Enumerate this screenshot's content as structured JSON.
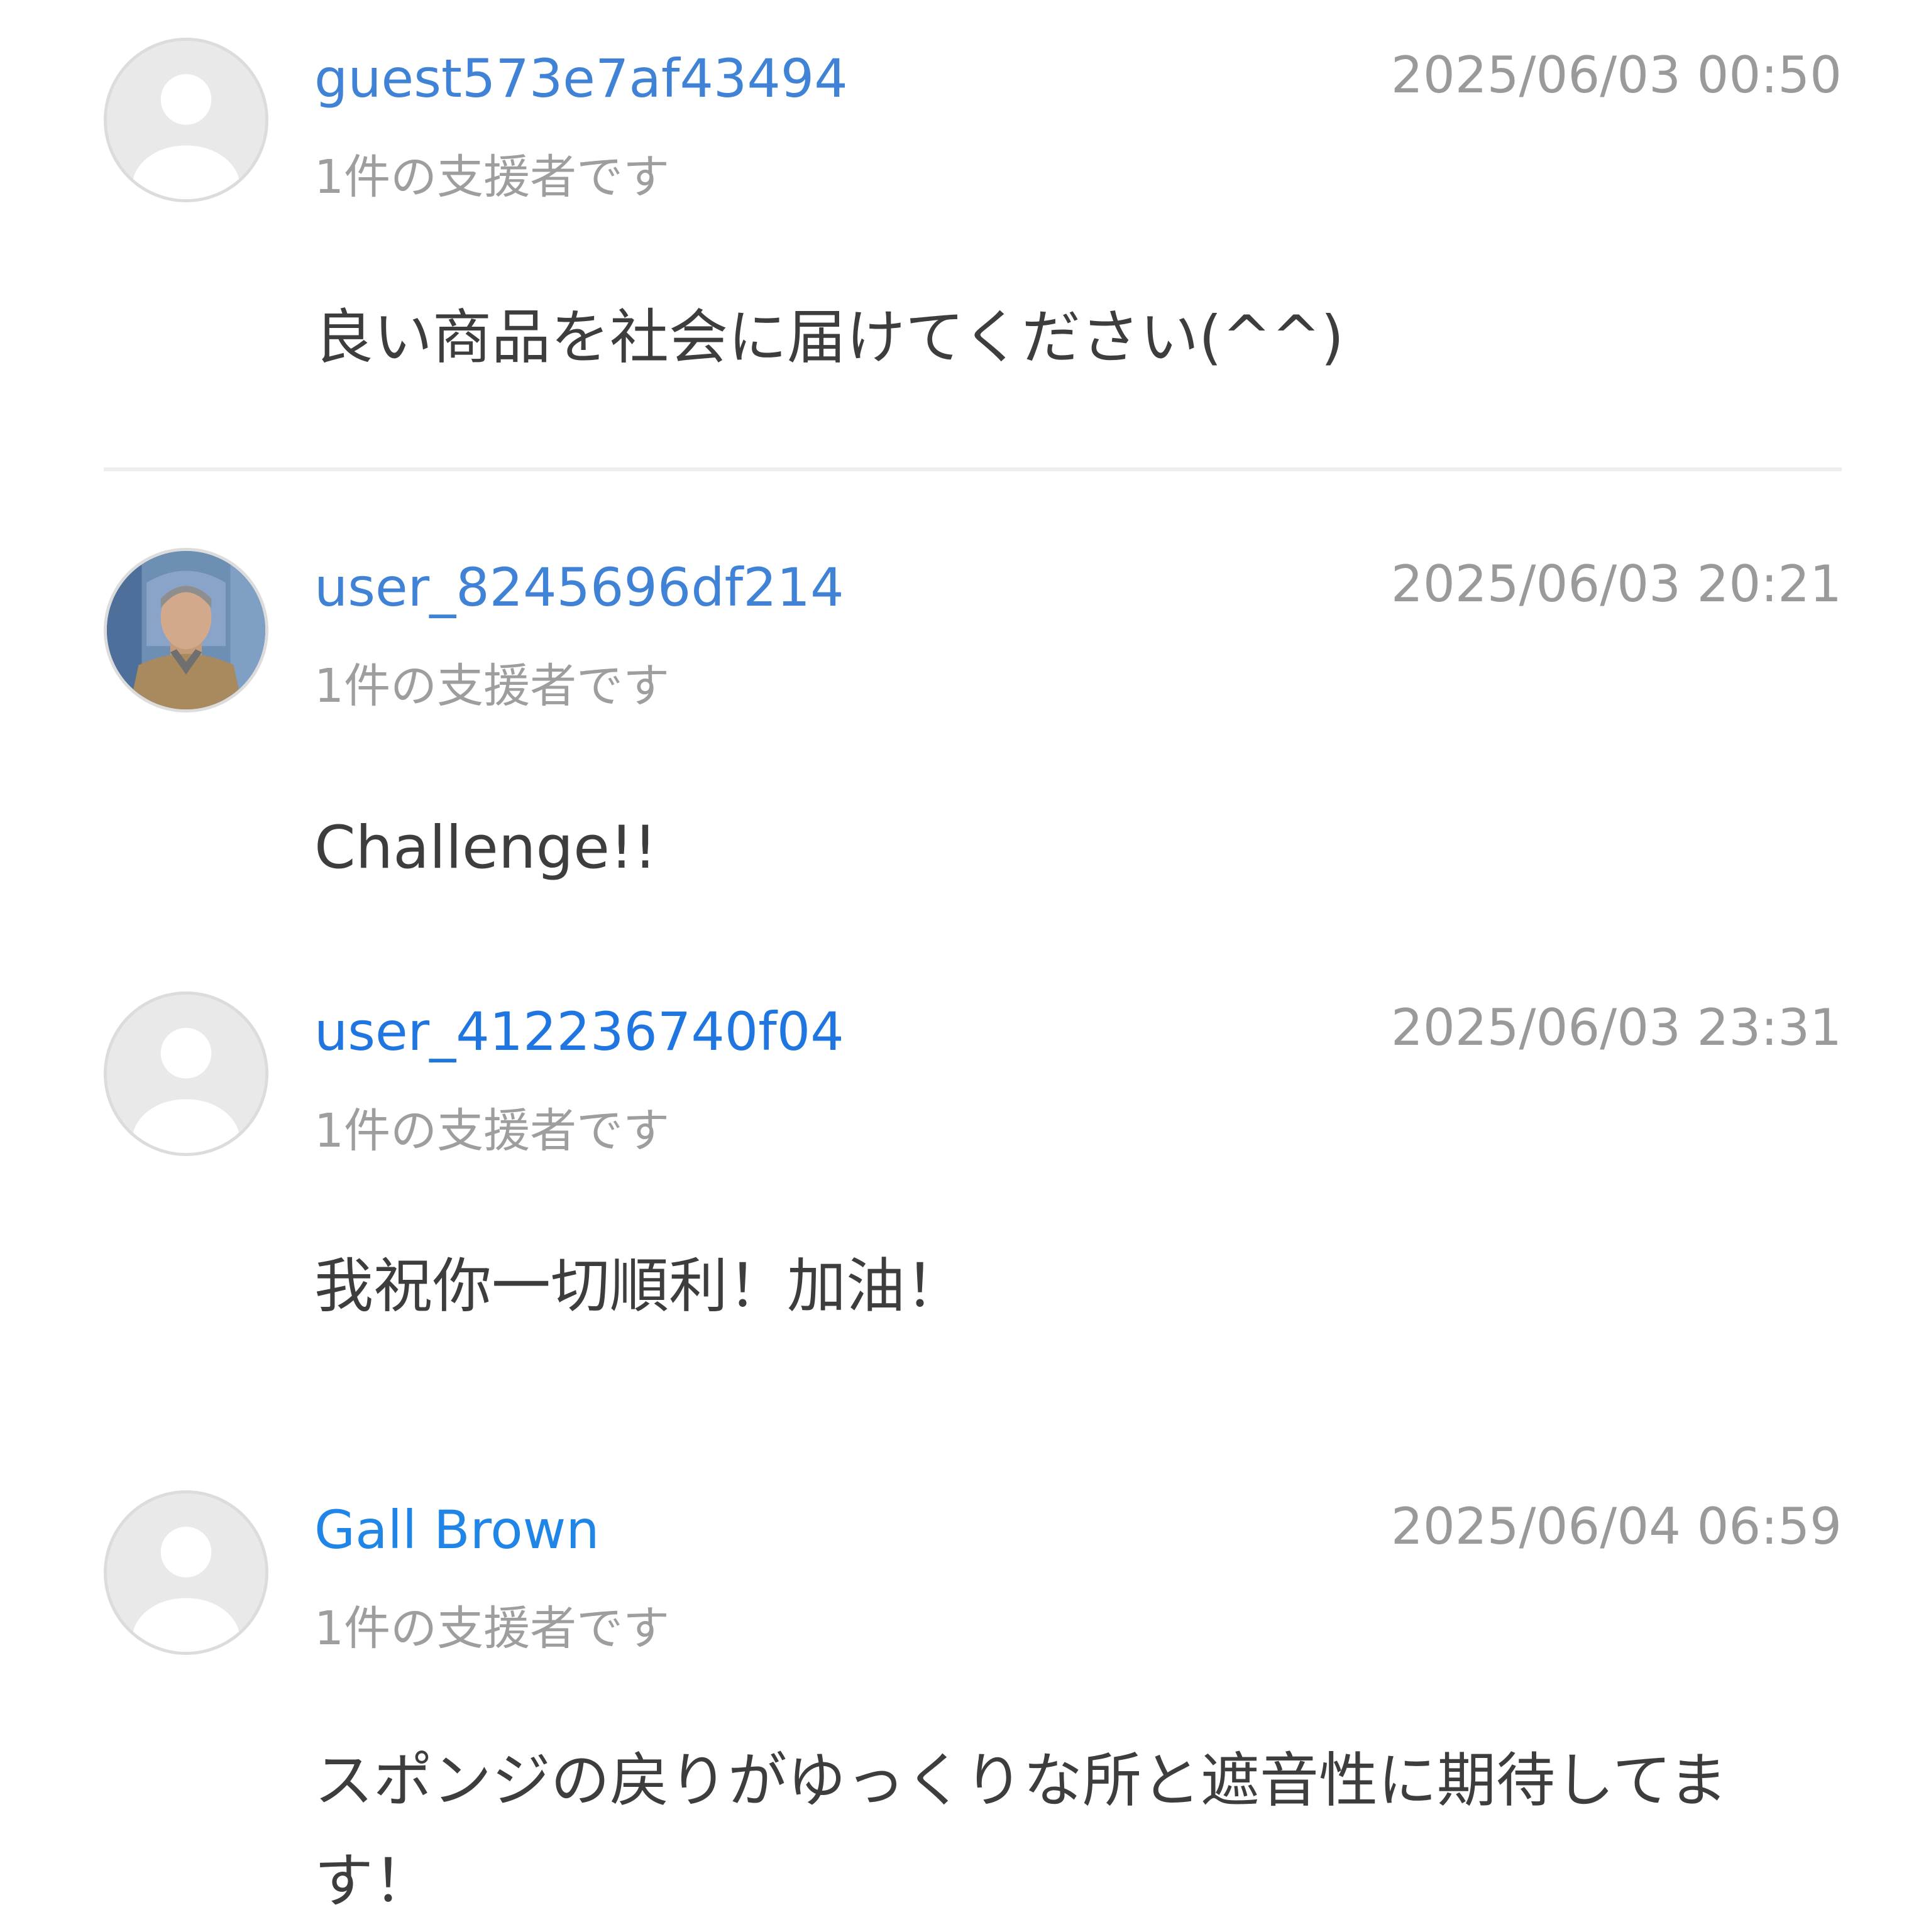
{
  "theme": {
    "username_color_default": "#3f82d6",
    "username_color_named": "#1f86e8",
    "timestamp_color": "#9a9a9a",
    "meta_color": "#9e9e9e",
    "text_color": "#3d3d3d"
  },
  "comments": [
    {
      "avatar": "default-user-icon",
      "username": "guest573e7af43494",
      "timestamp": "2025/06/03 00:50",
      "supporter_text": "1件の支援者です",
      "message": "良い商品を社会に届けてください(^^)"
    },
    {
      "avatar": "profile-photo",
      "username": "user_8245696df214",
      "timestamp": "2025/06/03 20:21",
      "supporter_text": "1件の支援者です",
      "message": "Challenge!!"
    },
    {
      "avatar": "default-user-icon",
      "username": "user_412236740f04",
      "timestamp": "2025/06/03 23:31",
      "supporter_text": "1件の支援者です",
      "message": "我祝你一切順利！加油！"
    },
    {
      "avatar": "default-user-icon",
      "username": "Gall Brown",
      "timestamp": "2025/06/04 06:59",
      "supporter_text": "1件の支援者です",
      "message": "スポンジの戻りがゆっくりな所と遮音性に期待してます！"
    }
  ]
}
